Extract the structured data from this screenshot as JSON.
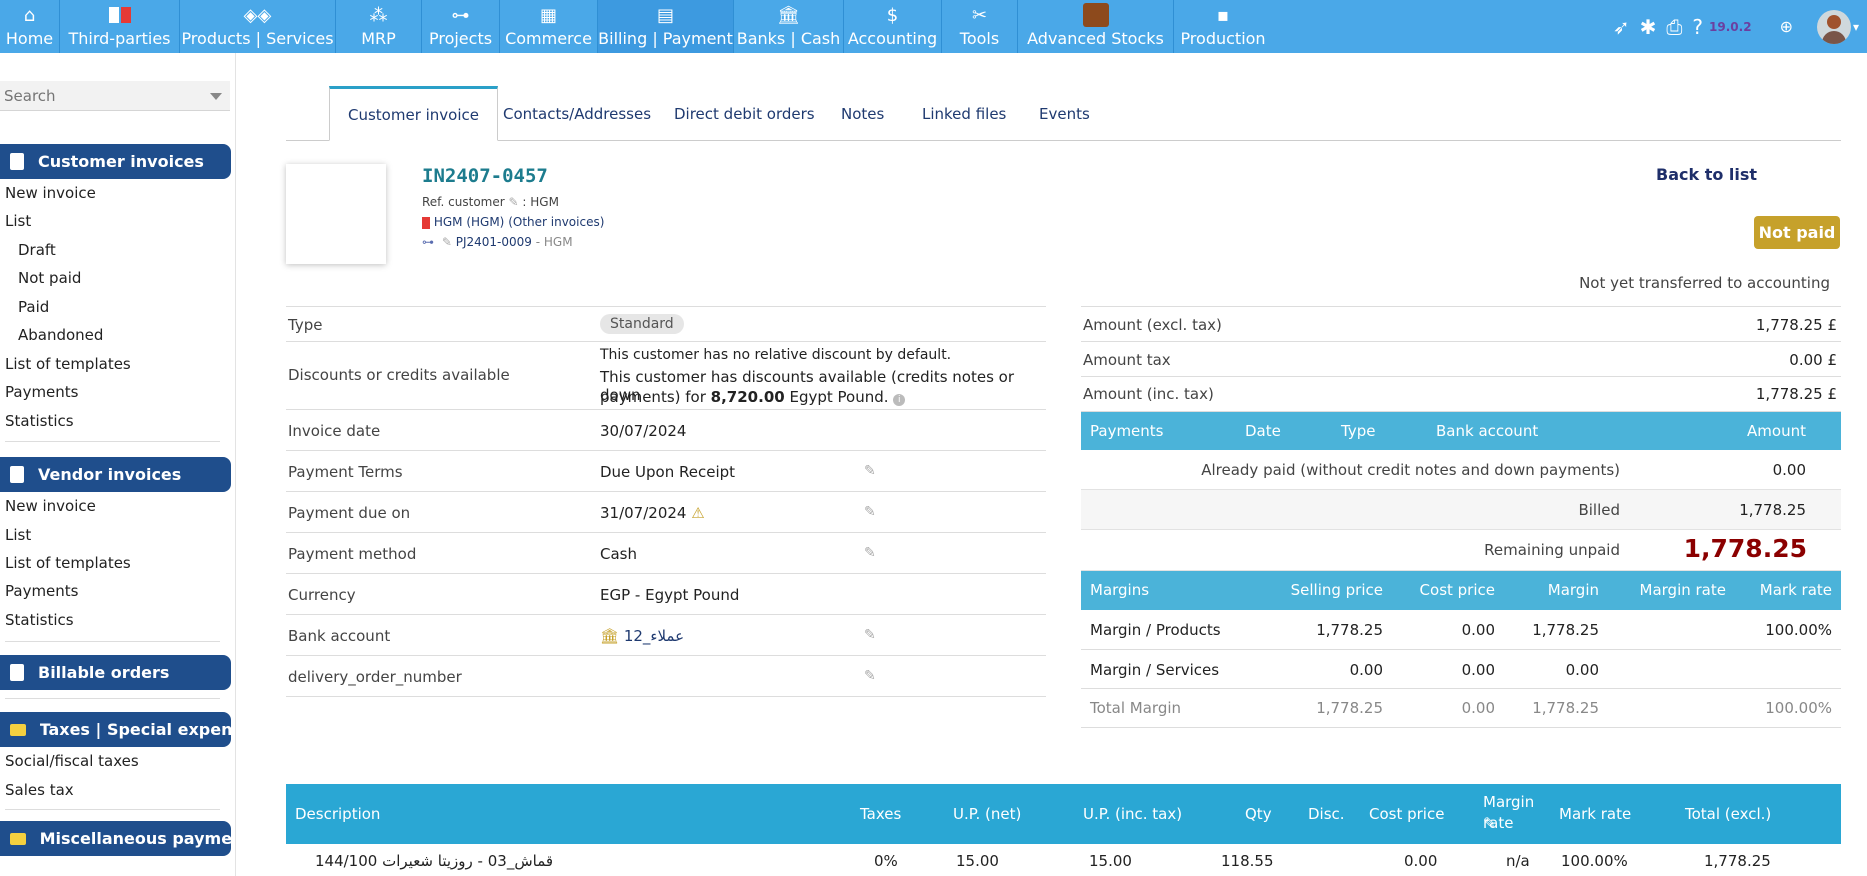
{
  "topmenu": [
    {
      "label": "Home",
      "icon": "home-icon"
    },
    {
      "label": "Third-parties",
      "icon": "building-icon"
    },
    {
      "label": "Products | Services",
      "icon": "cube-icon"
    },
    {
      "label": "MRP",
      "icon": "cubes-icon"
    },
    {
      "label": "Projects",
      "icon": "sitemap-icon"
    },
    {
      "label": "Commerce",
      "icon": "suitcase-icon"
    },
    {
      "label": "Billing | Payment",
      "icon": "coins-icon"
    },
    {
      "label": "Banks | Cash",
      "icon": "bank-icon"
    },
    {
      "label": "Accounting",
      "icon": "search-dollar-icon"
    },
    {
      "label": "Tools",
      "icon": "tools-icon"
    },
    {
      "label": "Advanced Stocks",
      "icon": "boxes-icon"
    },
    {
      "label": "Production",
      "icon": "note-icon"
    }
  ],
  "version": "19.0.2",
  "search": {
    "placeholder": "Search"
  },
  "sidebar": {
    "customer_invoices": {
      "title": "Customer invoices",
      "items": [
        "New invoice",
        "List",
        "Draft",
        "Not paid",
        "Paid",
        "Abandoned",
        "List of templates",
        "Payments",
        "Statistics"
      ]
    },
    "vendor_invoices": {
      "title": "Vendor invoices",
      "items": [
        "New invoice",
        "List",
        "List of templates",
        "Payments",
        "Statistics"
      ]
    },
    "billable_orders": {
      "title": "Billable orders"
    },
    "taxes": {
      "title": "Taxes | Special expens...",
      "items": [
        "Social/fiscal taxes",
        "Sales tax"
      ]
    },
    "misc_payments": {
      "title": "Miscellaneous payments"
    }
  },
  "tabs": [
    "Customer invoice",
    "Contacts/Addresses",
    "Direct debit orders",
    "Notes",
    "Linked files",
    "Events"
  ],
  "invoice": {
    "ref": "IN2407-0457",
    "ref_customer_label": "Ref. customer",
    "ref_customer_value": ": HGM",
    "thirdparty": "HGM (HGM)",
    "other_invoices": "(Other invoices)",
    "project_ref": "PJ2401-0009",
    "project_name": "- HGM",
    "back_to_list": "Back to list",
    "status": "Not paid",
    "accounting_status": "Not yet transferred to accounting"
  },
  "details": {
    "type_label": "Type",
    "type_value": "Standard",
    "discounts_label": "Discounts or credits available",
    "discounts_line1": "This customer has no relative discount by default.",
    "discounts_line2a": "This customer has discounts available (credits notes or down",
    "discounts_line2b": "payments) for",
    "discounts_amount": "8,720.00",
    "discounts_currency": "Egypt Pound.",
    "invoice_date_label": "Invoice date",
    "invoice_date": "30/07/2024",
    "payment_terms_label": "Payment Terms",
    "payment_terms": "Due Upon Receipt",
    "due_label": "Payment due on",
    "due": "31/07/2024",
    "method_label": "Payment method",
    "method": "Cash",
    "currency_label": "Currency",
    "currency": "EGP - Egypt Pound",
    "bank_label": "Bank account",
    "bank": "عملاء_12",
    "delivery_label": "delivery_order_number"
  },
  "amounts": {
    "excl_label": "Amount (excl. tax)",
    "excl": "1,778.25 £",
    "tax_label": "Amount tax",
    "tax": "0.00 £",
    "inc_label": "Amount (inc. tax)",
    "inc": "1,778.25 £"
  },
  "payments": {
    "headers": [
      "Payments",
      "Date",
      "Type",
      "Bank account",
      "Amount"
    ],
    "already_paid_label": "Already paid (without credit notes and down payments)",
    "already_paid": "0.00",
    "billed_label": "Billed",
    "billed": "1,778.25",
    "remaining_label": "Remaining unpaid",
    "remaining": "1,778.25"
  },
  "margins": {
    "headers": [
      "Margins",
      "Selling price",
      "Cost price",
      "Margin",
      "Margin rate",
      "Mark rate"
    ],
    "rows": [
      {
        "label": "Margin / Products",
        "selling": "1,778.25",
        "cost": "0.00",
        "margin": "1,778.25",
        "rate": "",
        "mark": "100.00%"
      },
      {
        "label": "Margin / Services",
        "selling": "0.00",
        "cost": "0.00",
        "margin": "0.00",
        "rate": "",
        "mark": ""
      },
      {
        "label": "Total Margin",
        "selling": "1,778.25",
        "cost": "0.00",
        "margin": "1,778.25",
        "rate": "",
        "mark": "100.00%"
      }
    ]
  },
  "lines": {
    "headers": {
      "description": "Description",
      "taxes": "Taxes",
      "up_net": "U.P. (net)",
      "up_inc": "U.P. (inc. tax)",
      "qty": "Qty",
      "disc": "Disc.",
      "cost": "Cost price",
      "margin_rate_1": "Margin",
      "margin_rate_2": "rate",
      "mark": "Mark rate",
      "total": "Total (excl.)"
    },
    "row": {
      "description": "قماش_03 - روزيتا شعيرات 144/100",
      "taxes": "0%",
      "up_net": "15.00",
      "up_inc": "15.00",
      "qty": "118.55",
      "disc": "",
      "cost": "0.00",
      "margin_rate": "n/a",
      "mark": "100.00%",
      "total": "1,778.25"
    }
  },
  "colors": {
    "topbar": "#4aa8e8",
    "sidebar_section": "#1f4e8c",
    "table_head": "#4bb3d9",
    "status_badge": "#c6a12b",
    "remaining": "#8b0000"
  }
}
